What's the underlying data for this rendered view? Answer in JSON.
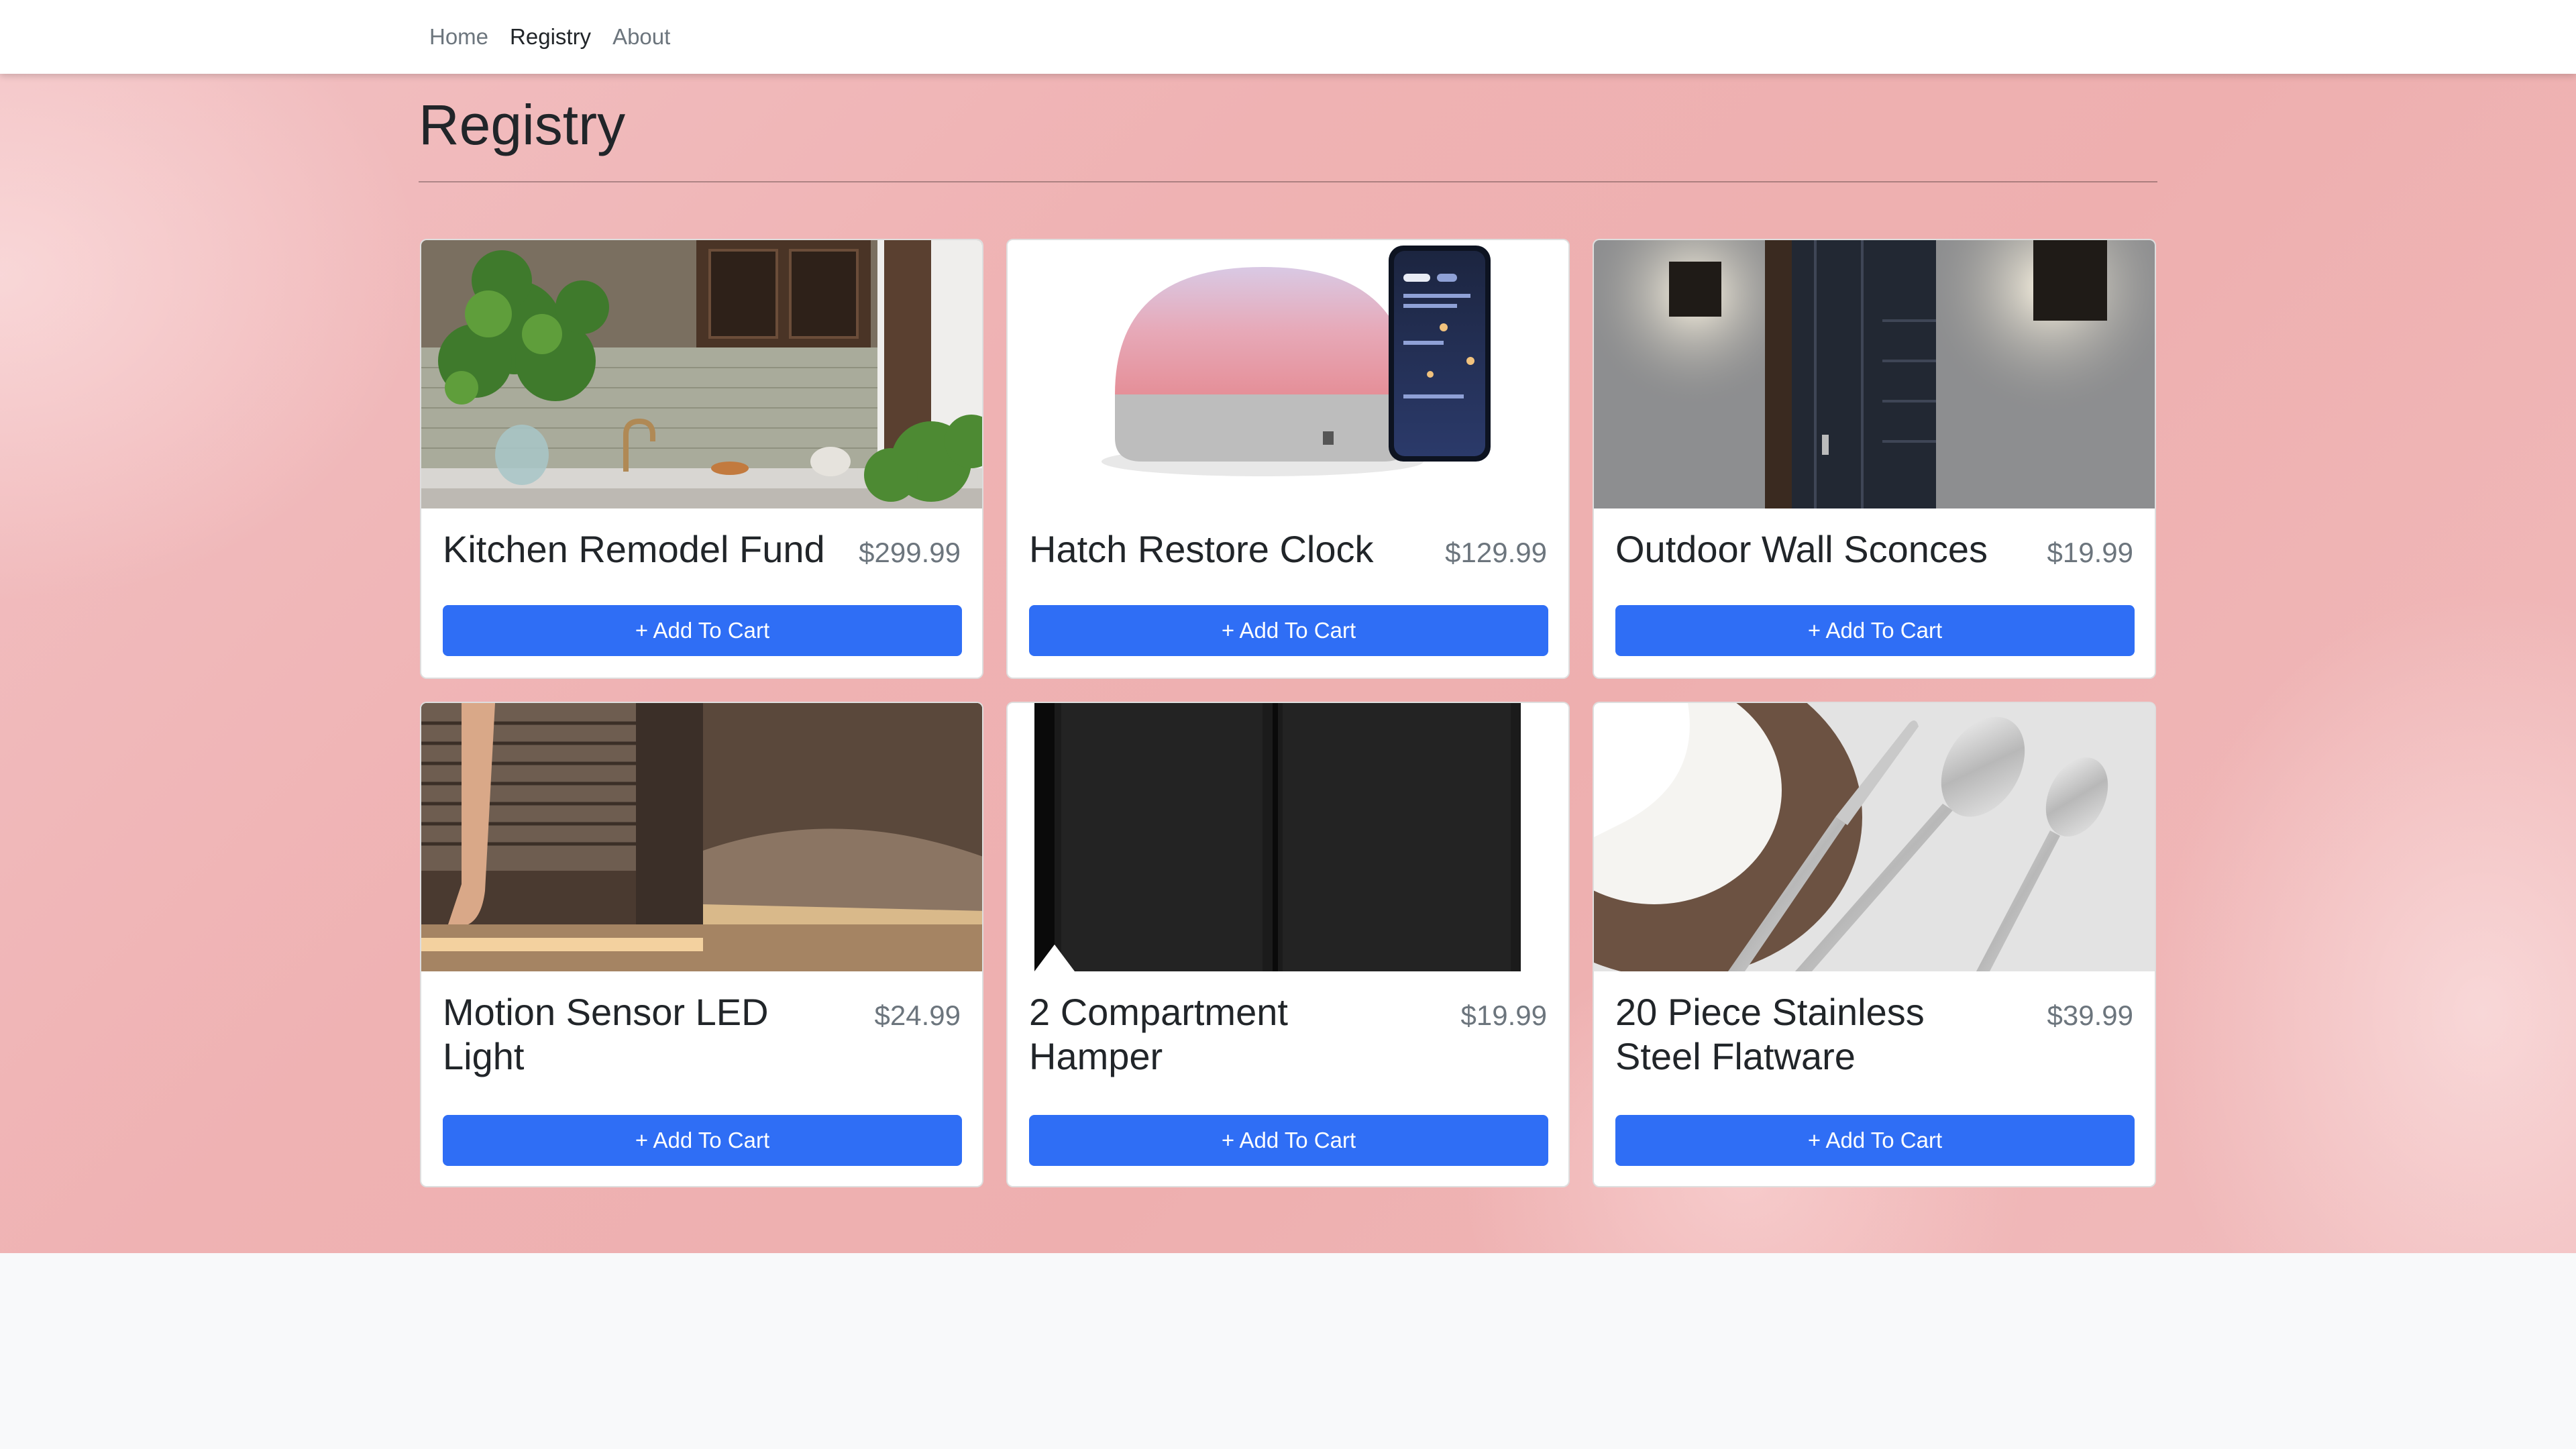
{
  "nav": {
    "links": [
      {
        "label": "Home",
        "active": false
      },
      {
        "label": "Registry",
        "active": true
      },
      {
        "label": "About",
        "active": false
      }
    ]
  },
  "page": {
    "title": "Registry"
  },
  "colors": {
    "button": "#2f6ef5",
    "hero_pink": "#efb2b3",
    "price": "#6c757d"
  },
  "products": [
    {
      "name": "Kitchen Remodel Fund",
      "price": "$299.99",
      "button": "+ Add To Cart"
    },
    {
      "name": "Hatch Restore Clock",
      "price": "$129.99",
      "button": "+ Add To Cart"
    },
    {
      "name": "Outdoor Wall Sconces",
      "price": "$19.99",
      "button": "+ Add To Cart"
    },
    {
      "name": "Motion Sensor LED Light",
      "price": "$24.99",
      "button": "+ Add To Cart"
    },
    {
      "name": "2 Compartment Hamper",
      "price": "$19.99",
      "button": "+ Add To Cart"
    },
    {
      "name": "20 Piece Stainless Steel Flatware",
      "price": "$39.99",
      "button": "+ Add To Cart"
    }
  ]
}
